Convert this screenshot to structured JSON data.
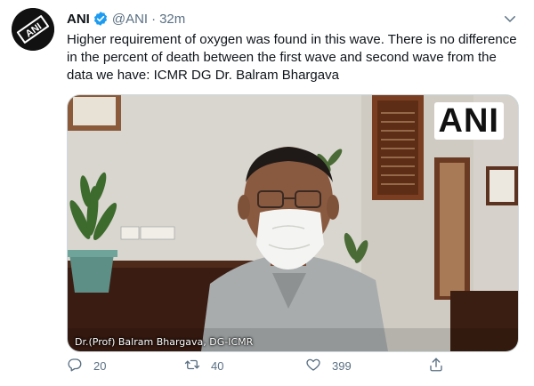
{
  "tweet": {
    "author_name": "ANI",
    "author_handle": "@ANI",
    "separator": "·",
    "timestamp": "32m",
    "text": "Higher requirement of oxygen was found in this wave. There is no difference in the percent of death between the first wave and second wave from the data we have: ICMR DG Dr. Balram Bhargava",
    "avatar_text": "ANI",
    "verified": true,
    "media": {
      "watermark": "ANI",
      "caption": "Dr.(Prof) Balram Bhargava, DG-ICMR"
    },
    "actions": {
      "reply_count": "20",
      "retweet_count": "40",
      "like_count": "399"
    }
  },
  "colors": {
    "verified_blue": "#1d9bf0",
    "secondary_text": "#5b7083",
    "primary_text": "#0f1419"
  },
  "icons": [
    "verified-badge-icon",
    "caret-down-icon",
    "reply-icon",
    "retweet-icon",
    "like-icon",
    "share-icon"
  ]
}
